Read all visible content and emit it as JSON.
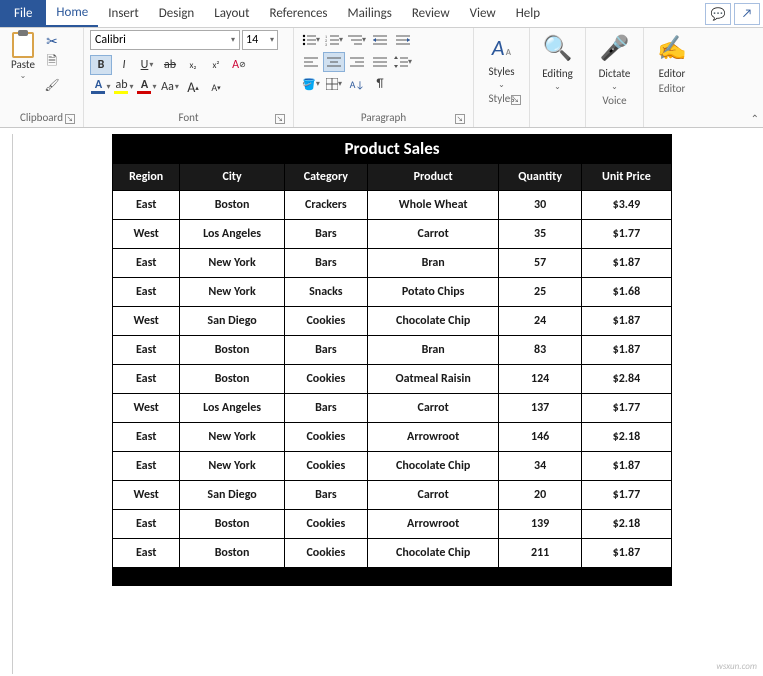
{
  "tabs": {
    "file": "File",
    "items": [
      "Home",
      "Insert",
      "Design",
      "Layout",
      "References",
      "Mailings",
      "Review",
      "View",
      "Help"
    ],
    "active": 0
  },
  "ribbon": {
    "clipboard": {
      "paste": "Paste",
      "label": "Clipboard"
    },
    "font": {
      "name": "Calibri",
      "size": "14",
      "bold": "B",
      "italic": "I",
      "underline": "U",
      "strike": "ab",
      "sub": "x₂",
      "sup": "x²",
      "clear": "A",
      "effects": "A",
      "highlight": "ab",
      "color": "A",
      "case": "Aa",
      "grow": "A",
      "shrink": "A",
      "label": "Font"
    },
    "paragraph": {
      "label": "Paragraph",
      "pilcrow": "¶"
    },
    "styles": {
      "big": "A",
      "small": "ᴀ",
      "caption": "Styles",
      "label": "Styles"
    },
    "editing": {
      "caption": "Editing"
    },
    "dictate": {
      "caption": "Dictate",
      "label": "Voice"
    },
    "editor": {
      "caption": "Editor",
      "label": "Editor"
    }
  },
  "doc": {
    "title": "Product Sales",
    "headers": [
      "Region",
      "City",
      "Category",
      "Product",
      "Quantity",
      "Unit Price"
    ],
    "rows": [
      [
        "East",
        "Boston",
        "Crackers",
        "Whole Wheat",
        "30",
        "$3.49"
      ],
      [
        "West",
        "Los Angeles",
        "Bars",
        "Carrot",
        "35",
        "$1.77"
      ],
      [
        "East",
        "New York",
        "Bars",
        "Bran",
        "57",
        "$1.87"
      ],
      [
        "East",
        "New York",
        "Snacks",
        "Potato Chips",
        "25",
        "$1.68"
      ],
      [
        "West",
        "San Diego",
        "Cookies",
        "Chocolate Chip",
        "24",
        "$1.87"
      ],
      [
        "East",
        "Boston",
        "Bars",
        "Bran",
        "83",
        "$1.87"
      ],
      [
        "East",
        "Boston",
        "Cookies",
        "Oatmeal Raisin",
        "124",
        "$2.84"
      ],
      [
        "West",
        "Los Angeles",
        "Bars",
        "Carrot",
        "137",
        "$1.77"
      ],
      [
        "East",
        "New York",
        "Cookies",
        "Arrowroot",
        "146",
        "$2.18"
      ],
      [
        "East",
        "New York",
        "Cookies",
        "Chocolate Chip",
        "34",
        "$1.87"
      ],
      [
        "West",
        "San Diego",
        "Bars",
        "Carrot",
        "20",
        "$1.77"
      ],
      [
        "East",
        "Boston",
        "Cookies",
        "Arrowroot",
        "139",
        "$2.18"
      ],
      [
        "East",
        "Boston",
        "Cookies",
        "Chocolate Chip",
        "211",
        "$1.87"
      ]
    ]
  },
  "watermark": "wsxun.com"
}
